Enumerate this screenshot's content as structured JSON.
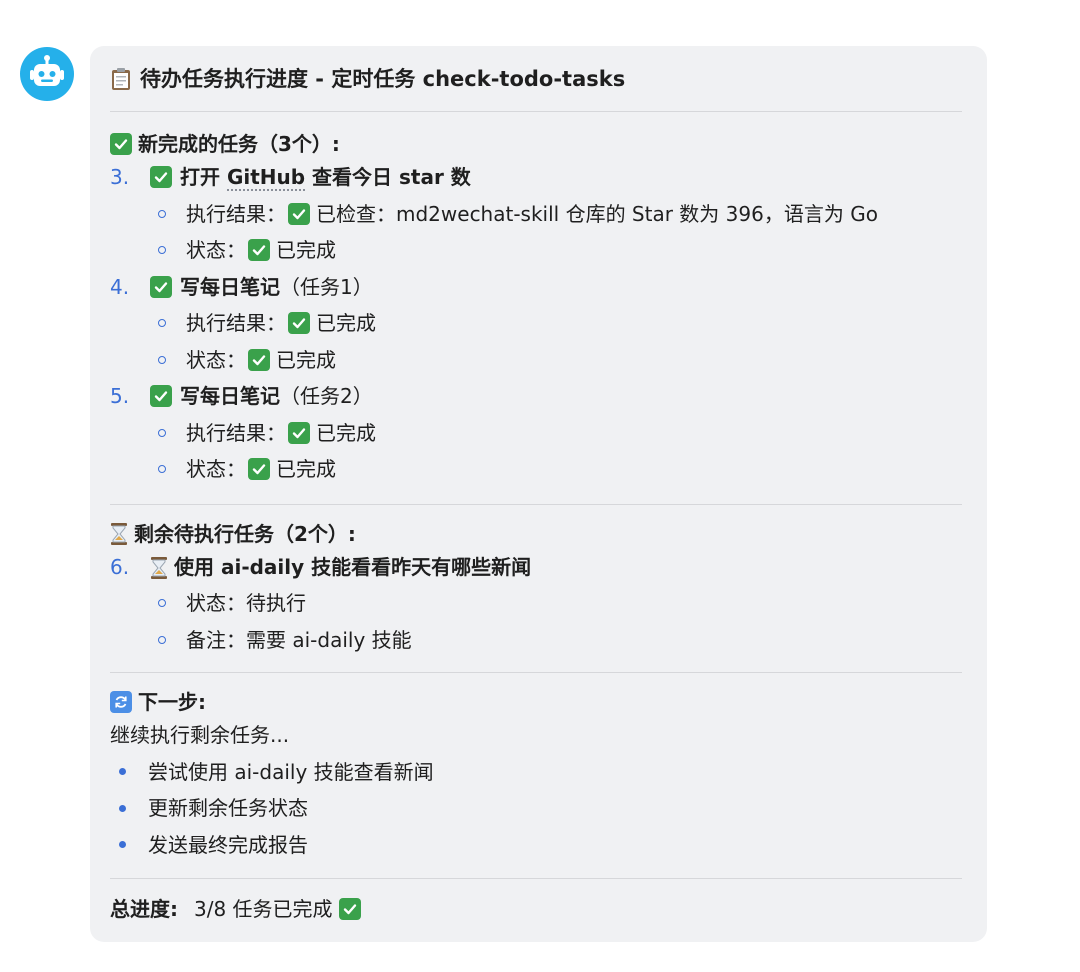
{
  "title": "待办任务执行进度 - 定时任务 check-todo-tasks",
  "completed": {
    "heading": "新完成的任务（3个）:",
    "tasks": [
      {
        "num": "3.",
        "pre": "打开 ",
        "link": "GitHub",
        "post": " 查看今日 star 数",
        "result_label": "执行结果：",
        "result_text": "已检查：md2wechat-skill 仓库的 Star 数为 396，语言为 Go",
        "status_label": "状态：",
        "status_text": "已完成"
      },
      {
        "num": "4.",
        "name": "写每日笔记",
        "suffix": "（任务1）",
        "result_label": "执行结果：",
        "result_text": "已完成",
        "status_label": "状态：",
        "status_text": "已完成"
      },
      {
        "num": "5.",
        "name": "写每日笔记",
        "suffix": "（任务2）",
        "result_label": "执行结果：",
        "result_text": "已完成",
        "status_label": "状态：",
        "status_text": "已完成"
      }
    ]
  },
  "pending": {
    "heading": "剩余待执行任务（2个）:",
    "task": {
      "num": "6.",
      "name": "使用 ai-daily 技能看看昨天有哪些新闻",
      "status_label": "状态：",
      "status_text": "待执行",
      "note_label": "备注：",
      "note_text": "需要 ai-daily 技能"
    }
  },
  "next": {
    "heading": "下一步:",
    "intro": "继续执行剩余任务...",
    "items": [
      "尝试使用 ai-daily 技能查看新闻",
      "更新剩余任务状态",
      "发送最终完成报告"
    ]
  },
  "total": {
    "label": "总进度:",
    "value": "3/8 任务已完成"
  },
  "icons": {
    "avatar": "robot-icon",
    "title": "clipboard-icon",
    "done": "check-mark-icon",
    "pending": "hourglass-icon",
    "next": "refresh-icon"
  },
  "colors": {
    "accent": "#3b6fd6",
    "check": "#3aa14b",
    "avatar": "#25b0ea",
    "bubble": "#f0f1f3"
  }
}
